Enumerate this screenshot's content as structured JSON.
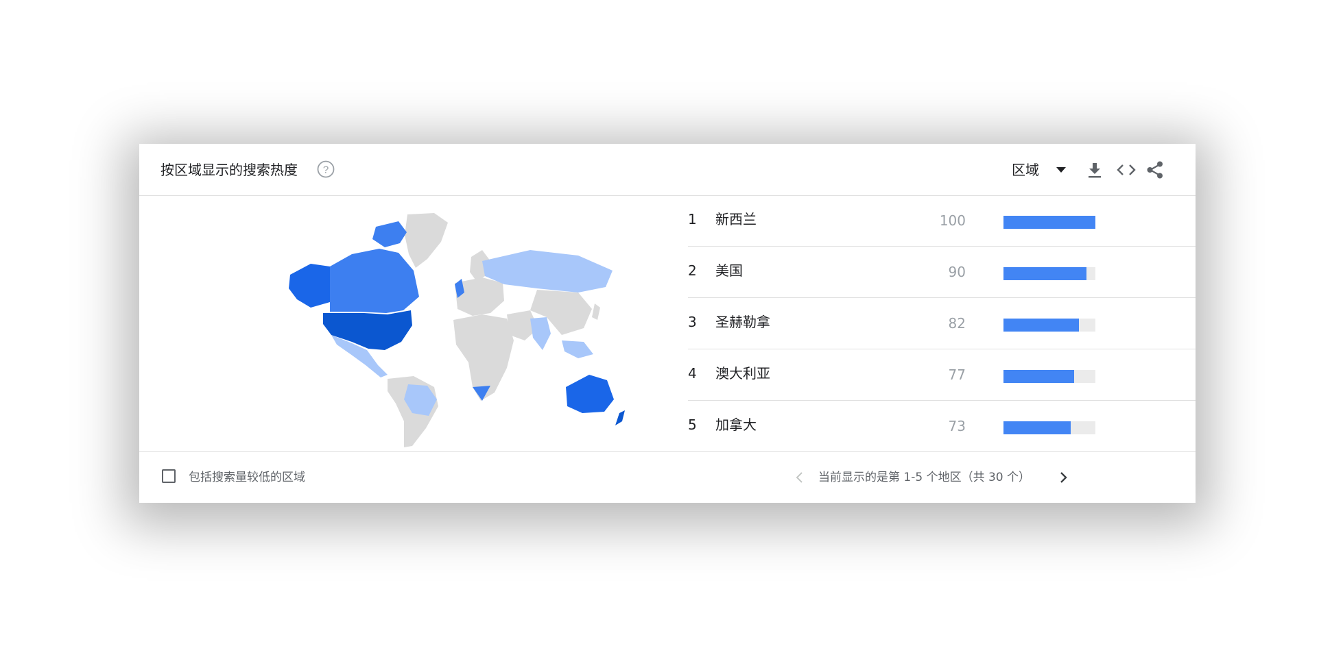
{
  "header": {
    "title": "按区域显示的搜索热度",
    "help_icon": "help-circle-icon",
    "region_selector": "区域",
    "dropdown_icon": "triangle-down-icon",
    "download_icon": "download-icon",
    "embed_icon": "code-brackets-icon",
    "share_icon": "share-icon"
  },
  "colors": {
    "accent": "#4285f4",
    "bar_track": "#ebebeb",
    "map_none": "#dadada",
    "map_low": "#a8c7fa",
    "map_mid": "#3d7ff0",
    "map_high": "#1a66e8",
    "map_top": "#0b57d0"
  },
  "regions": [
    {
      "rank": "1",
      "name": "新西兰",
      "score": "100",
      "value": 100
    },
    {
      "rank": "2",
      "name": "美国",
      "score": "90",
      "value": 90
    },
    {
      "rank": "3",
      "name": "圣赫勒拿",
      "score": "82",
      "value": 82
    },
    {
      "rank": "4",
      "name": "澳大利亚",
      "score": "77",
      "value": 77
    },
    {
      "rank": "5",
      "name": "加拿大",
      "score": "73",
      "value": 73
    }
  ],
  "footer": {
    "checkbox_label": "包括搜索量较低的区域",
    "checkbox_checked": false,
    "pager_text": "当前显示的是第 1-5 个地区（共 30 个）",
    "prev_icon": "chevron-left-icon",
    "next_icon": "chevron-right-icon"
  }
}
